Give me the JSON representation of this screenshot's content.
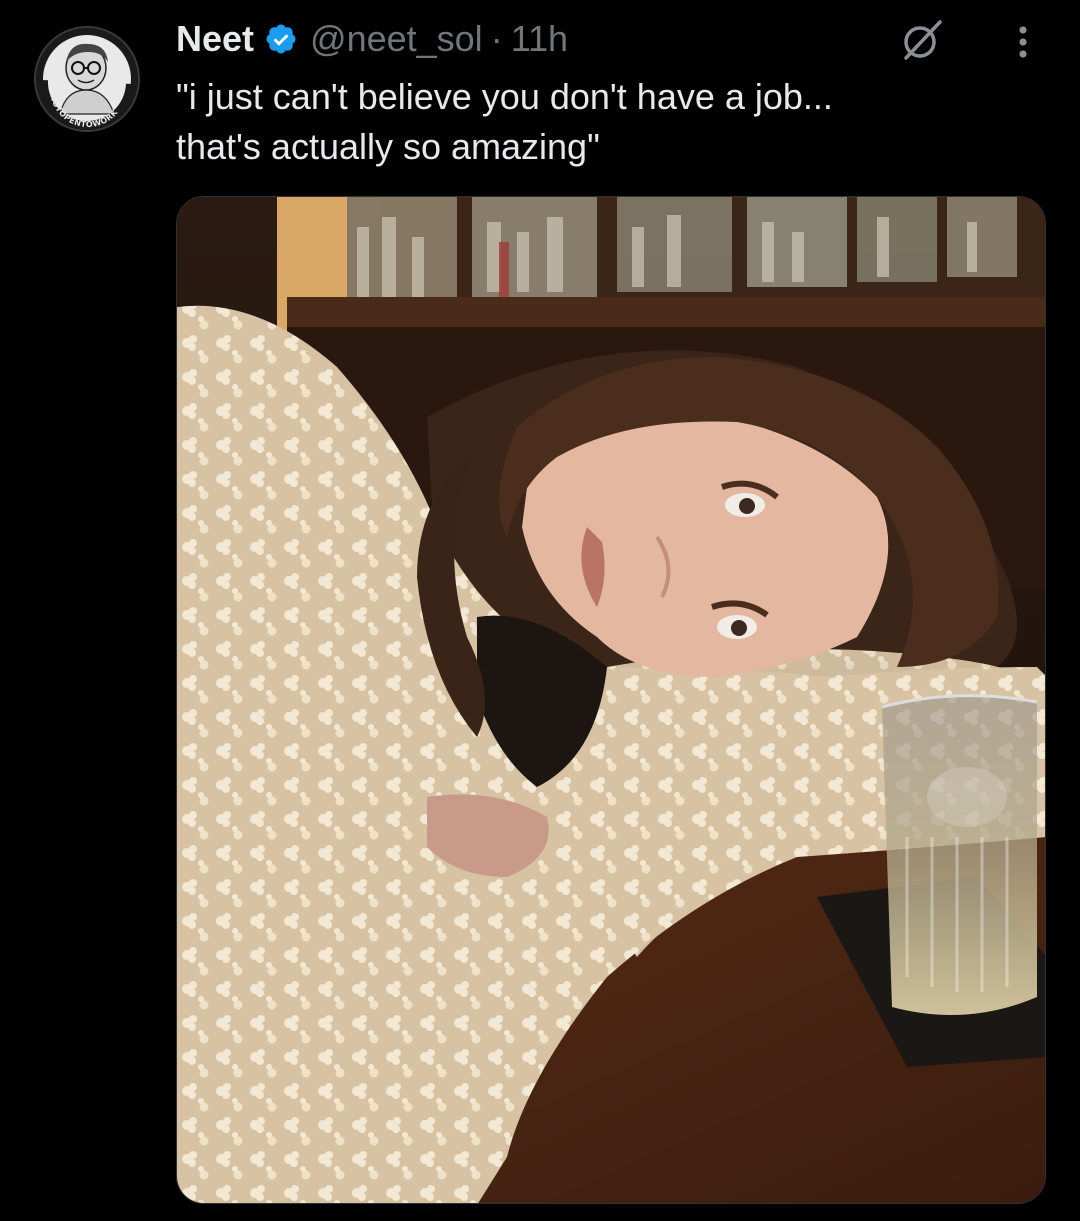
{
  "tweet": {
    "author": {
      "name": "Neet",
      "handle": "@neet_sol",
      "verified": true,
      "avatar_icon": "avatar-cartoon-icon",
      "avatar_text": "#NOTOPENTOWORK"
    },
    "time": "11h",
    "separator": "·",
    "text_lines": [
      "\"i just can't believe you don't have a job...",
      "that's actually so amazing\""
    ],
    "actions": {
      "grok_icon": "grok-icon",
      "more_icon": "more-vertical-icon"
    },
    "colors": {
      "background": "#000000",
      "text": "#e7e9ea",
      "secondary": "#71767b",
      "verified": "#1d9bf0"
    }
  }
}
